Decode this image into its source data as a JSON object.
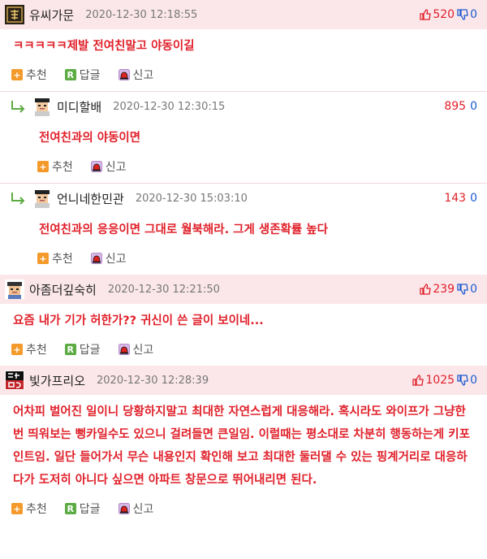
{
  "labels": {
    "recommend": "추천",
    "reply": "답글",
    "report": "신고"
  },
  "c1": {
    "author": "유씨가문",
    "date": "2020-12-30 12:18:55",
    "up": "520",
    "down": "0",
    "text": "ㅋㅋㅋㅋㅋ제발 전여친말고 야동이길"
  },
  "c2": {
    "author": "미디할배",
    "date": "2020-12-30 12:30:15",
    "up": "895",
    "down": "0",
    "text": "전여친과의 야동이면"
  },
  "c3": {
    "author": "언니네한민관",
    "date": "2020-12-30 15:03:10",
    "up": "143",
    "down": "0",
    "text": "전여친과의 응응이면 그대로 월북해라. 그게 생존확률 높다"
  },
  "c4": {
    "author": "아좀더깊숙히",
    "date": "2020-12-30 12:21:50",
    "up": "239",
    "down": "0",
    "text": "요즘 내가 기가 허한가?? 귀신이 쓴 글이 보이네..."
  },
  "c5": {
    "author": "빛가프리오",
    "date": "2020-12-30 12:28:39",
    "up": "1025",
    "down": "0",
    "text": "어차피 벌어진 일이니 당황하지말고 최대한 자연스럽게 대응해라. 혹시라도 와이프가 그냥한번 띄워보는 뻥카일수도 있으니 걸려들면 큰일임. 이럴때는 평소대로 차분히 행동하는게 키포인트임. 일단 들어가서 무슨 내용인지 확인해 보고 최대한 둘러댈 수 있는 핑계거리로 대응하다가 도저히 아니다 싶으면 아파트 창문으로 뛰어내리면 된다."
  }
}
